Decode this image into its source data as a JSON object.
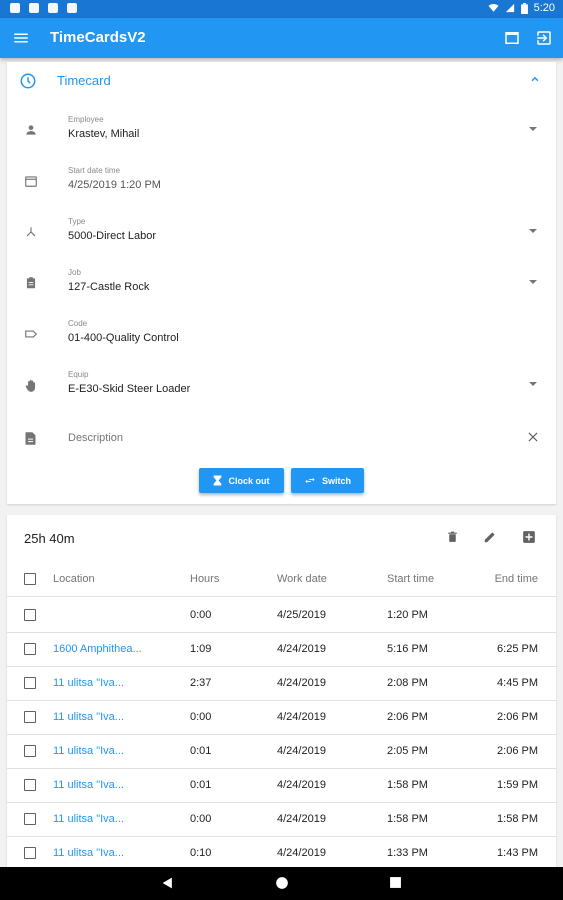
{
  "status_bar": {
    "time": "5:20"
  },
  "app_bar": {
    "title": "TimeCardsV2",
    "icons": [
      "menu-icon",
      "window-icon",
      "exit-icon"
    ]
  },
  "timecard": {
    "header": "Timecard",
    "fields": [
      {
        "caption": "Employee",
        "value": "Krastev, Mihail",
        "icon": "person-icon"
      },
      {
        "caption": "Start date time",
        "value": "4/25/2019 1:20 PM",
        "icon": "calendar-icon"
      },
      {
        "caption": "Type",
        "value": "5000-Direct Labor",
        "icon": "type-icon"
      },
      {
        "caption": "Job",
        "value": "127-Castle Rock",
        "icon": "clipboard-icon"
      },
      {
        "caption": "Code",
        "value": "01-400-Quality Control",
        "icon": "tag-icon"
      },
      {
        "caption": "Equip",
        "value": "E-E30-Skid Steer Loader",
        "icon": "hand-icon"
      }
    ],
    "description_placeholder": "Description",
    "clock_out_label": "Clock out",
    "switch_label": "Switch"
  },
  "entries": {
    "total": "25h 40m",
    "columns": {
      "location": "Location",
      "hours": "Hours",
      "work_date": "Work date",
      "start_time": "Start time",
      "end_time": "End time"
    },
    "rows": [
      {
        "location": "",
        "hours": "0:00",
        "work_date": "4/25/2019",
        "start_time": "1:20 PM",
        "end_time": ""
      },
      {
        "location": "1600 Amphithea...",
        "hours": "1:09",
        "work_date": "4/24/2019",
        "start_time": "5:16 PM",
        "end_time": "6:25 PM"
      },
      {
        "location": "11 ulitsa \"Iva...",
        "hours": "2:37",
        "work_date": "4/24/2019",
        "start_time": "2:08 PM",
        "end_time": "4:45 PM"
      },
      {
        "location": "11 ulitsa \"Iva...",
        "hours": "0:00",
        "work_date": "4/24/2019",
        "start_time": "2:06 PM",
        "end_time": "2:06 PM"
      },
      {
        "location": "11 ulitsa \"Iva...",
        "hours": "0:01",
        "work_date": "4/24/2019",
        "start_time": "2:05 PM",
        "end_time": "2:06 PM"
      },
      {
        "location": "11 ulitsa \"Iva...",
        "hours": "0:01",
        "work_date": "4/24/2019",
        "start_time": "1:58 PM",
        "end_time": "1:59 PM"
      },
      {
        "location": "11 ulitsa \"Iva...",
        "hours": "0:00",
        "work_date": "4/24/2019",
        "start_time": "1:58 PM",
        "end_time": "1:58 PM"
      },
      {
        "location": "11 ulitsa \"Iva...",
        "hours": "0:10",
        "work_date": "4/24/2019",
        "start_time": "1:33 PM",
        "end_time": "1:43 PM"
      }
    ]
  },
  "colors": {
    "primary": "#2196f3",
    "primary_dark": "#1976d2"
  }
}
